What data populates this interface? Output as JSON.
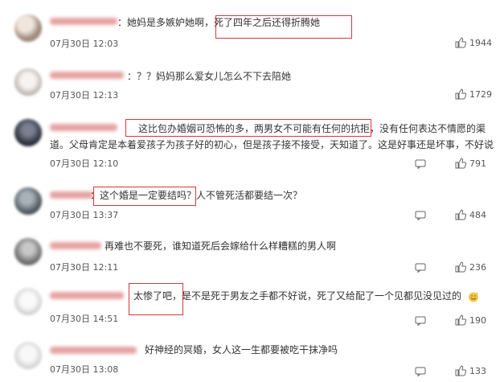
{
  "comments": [
    {
      "text": "：她妈是多嫉妒她啊，死了四年之后还得折腾她",
      "text_lines": [
        "：她妈是多嫉妒她啊，死了四年之后还得折腾她"
      ],
      "time": "07月30日 12:03",
      "likes": "1944",
      "highlighted": "死了四年之后还得折腾她"
    },
    {
      "text": "：？？妈妈那么爱女儿怎么不下去陪她",
      "text_lines": [
        "：？？妈妈那么爱女儿怎么不下去陪她"
      ],
      "time": "07月30日 12:13",
      "likes": "1729"
    },
    {
      "text_lines": [
        "这比包办婚姻可恐怖的多，两男女不可能有任何的抗拒，没有任何表达不情愿的渠",
        "道。父母肯定是本着爱孩子为孩子好的初心，但是孩子接不接受，天知道了。这是好事还是坏事，不好说"
      ],
      "time": "07月30日 12:10",
      "likes": "791",
      "highlighted": "这比包办婚姻可恐怖的多，两男女不可能有任何的抗拒"
    },
    {
      "text_lines": [
        "：这个婚是一定要结吗？人不管死活都要结一次？"
      ],
      "time": "07月30日 13:37",
      "likes": "484",
      "highlighted": "这个婚是一定要结吗？"
    },
    {
      "text_lines": [
        "再难也不要死，谁知道死后会嫁给什么样糟糕的男人啊"
      ],
      "time": "07月30日 12:11",
      "likes": "236"
    },
    {
      "text_lines": [
        "太惨了吧，是不是死于男友之手都不好说，死了又给配了一个见都见没见过的"
      ],
      "time": "07月30日 14:51",
      "likes": "190",
      "highlighted": "太惨了吧",
      "emoji": "sweat-smile-emoji"
    },
    {
      "text_lines": [
        "好神经的冥婚，女人这一生都要被吃干抹净吗"
      ],
      "time": "07月30日 13:08",
      "likes": "133"
    }
  ],
  "icons": {
    "reply": "comment-reply-icon",
    "like": "thumbs-up-icon"
  },
  "colors": {
    "highlight_box": "#d9363e",
    "text": "#333333",
    "meta": "#555555"
  }
}
